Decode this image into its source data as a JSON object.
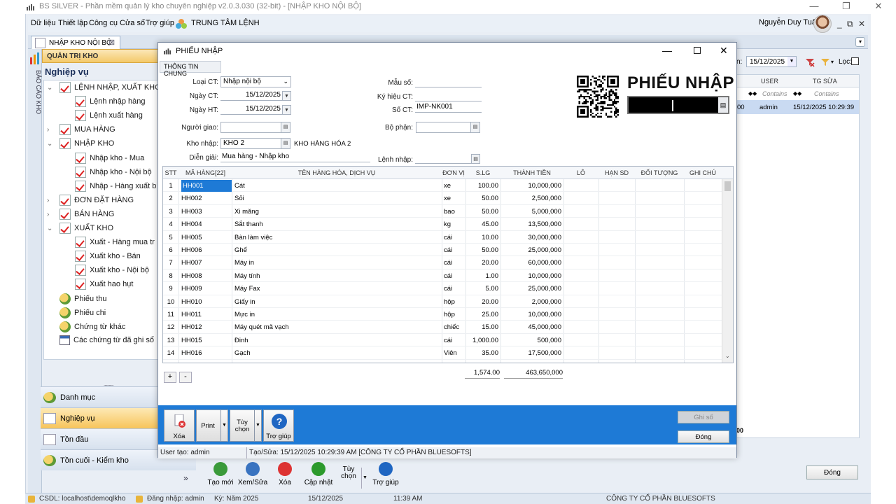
{
  "window": {
    "title": "BS SILVER - Phần mềm quản lý kho chuyên nghiệp v2.0.3.030 (32-bit) - [NHẬP KHO NỘI BỘ]",
    "minimize": "—",
    "restore": "❐",
    "close": "✕"
  },
  "menu": {
    "items": [
      "Dữ liệu",
      "Thiết lập",
      "Công cụ",
      "Cửa sổ",
      "Trợ giúp",
      "TRUNG TÂM LỆNH"
    ],
    "user_name": "Nguyễn Duy Tuấn",
    "mdi_min": "_",
    "mdi_restore": "⧉",
    "mdi_close": "✕"
  },
  "doc_tab": {
    "label": "NHẬP KHO NỘI BỘ",
    "close": "⊠"
  },
  "side_label": "BÁO CÁO KHO",
  "nav": {
    "header": "QUẢN TRỊ KHO",
    "title": "Nghiệp vụ",
    "tree": [
      {
        "label": "LỆNH NHẬP, XUẤT KHO",
        "level": 0,
        "icon": "check",
        "toggle": "v"
      },
      {
        "label": "Lệnh nhập hàng",
        "level": 1,
        "icon": "check"
      },
      {
        "label": "Lệnh xuất hàng",
        "level": 1,
        "icon": "check"
      },
      {
        "label": "MUA HÀNG",
        "level": 0,
        "icon": "check",
        "toggle": ">"
      },
      {
        "label": "NHẬP KHO",
        "level": 0,
        "icon": "check",
        "toggle": "v"
      },
      {
        "label": "Nhập kho - Mua",
        "level": 1,
        "icon": "check"
      },
      {
        "label": "Nhập kho - Nội bộ",
        "level": 1,
        "icon": "check"
      },
      {
        "label": "Nhập - Hàng xuất b",
        "level": 1,
        "icon": "check"
      },
      {
        "label": "ĐƠN ĐẶT HÀNG",
        "level": 0,
        "icon": "check",
        "toggle": ">"
      },
      {
        "label": "BÁN HÀNG",
        "level": 0,
        "icon": "check",
        "toggle": ">"
      },
      {
        "label": "XUẤT KHO",
        "level": 0,
        "icon": "check",
        "toggle": "v"
      },
      {
        "label": "Xuất - Hàng mua tr",
        "level": 1,
        "icon": "check"
      },
      {
        "label": "Xuất kho - Bán",
        "level": 1,
        "icon": "check"
      },
      {
        "label": "Xuất kho - Nội bộ",
        "level": 1,
        "icon": "check"
      },
      {
        "label": "Xuất hao hụt",
        "level": 1,
        "icon": "check"
      },
      {
        "label": "Phiếu thu",
        "level": 0,
        "icon": "coin"
      },
      {
        "label": "Phiếu chi",
        "level": 0,
        "icon": "coin"
      },
      {
        "label": "Chứng từ khác",
        "level": 0,
        "icon": "coin"
      },
      {
        "label": "Các chứng từ đã ghi sổ",
        "level": 0,
        "icon": "cal"
      }
    ],
    "bars": [
      {
        "label": "Danh mục",
        "selected": false
      },
      {
        "label": "Nghiệp vụ",
        "selected": true
      },
      {
        "label": "Tồn đầu",
        "selected": false
      },
      {
        "label": "Tồn cuối - Kiểm kho",
        "selected": false
      }
    ],
    "more": "»"
  },
  "right": {
    "date_label": "n:",
    "date": "15/12/2025",
    "filter_label": "Lọc:",
    "col_user": "USER",
    "col_tg": "TG SỬA",
    "contains1": "Contains",
    "contains2": "Contains",
    "row_val_prefix": "00",
    "row_user": "admin",
    "row_tg": "15/12/2025 10:29:39",
    "footer_prefix": "00"
  },
  "main_buttons": [
    {
      "label": "Tạo mới",
      "icon": "add-icon"
    },
    {
      "label": "Xem/Sửa",
      "icon": "edit-icon"
    },
    {
      "label": "Xóa",
      "icon": "delete-icon"
    },
    {
      "label": "Cập nhật",
      "icon": "check-icon"
    },
    {
      "label": "Tùy chọn",
      "icon": "options-icon"
    },
    {
      "label": "Trợ giúp",
      "icon": "help-icon"
    }
  ],
  "main_close": "Đóng",
  "status": {
    "db": "CSDL: localhost\\demoqlkho",
    "login": "Đăng nhập: admin",
    "period": "Kỳ: Năm 2025",
    "date": "15/12/2025",
    "time": "11:39 AM",
    "company": "CÔNG TY CỔ PHẦN BLUESOFTS"
  },
  "dialog": {
    "title": "PHIẾU NHẬP",
    "tab": "THÔNG TIN CHUNG",
    "big_title": "PHIẾU NHẬP",
    "fields": {
      "loai_ct_label": "Loại CT:",
      "loai_ct": "Nhập nội bộ",
      "ngay_ct_label": "Ngày CT:",
      "ngay_ct": "15/12/2025",
      "ngay_ht_label": "Ngày HT:",
      "ngay_ht": "15/12/2025",
      "nguoi_giao_label": "Người giao:",
      "nguoi_giao": "",
      "kho_nhap_label": "Kho nhập:",
      "kho_nhap": "KHO 2",
      "kho_nhap_name": "KHO HÀNG HÓA 2",
      "dien_giai_label": "Diễn giải:",
      "dien_giai": "Mua hàng - Nhập kho",
      "mau_so_label": "Mẫu số:",
      "mau_so": "",
      "ky_hieu_label": "Ký hiệu CT:",
      "ky_hieu": "",
      "so_ct_label": "Số CT:",
      "so_ct": "IMP-NK001",
      "bo_phan_label": "Bộ phận:",
      "bo_phan": "",
      "lenh_nhap_label": "Lệnh nhập:",
      "lenh_nhap": ""
    },
    "grid": {
      "headers": [
        "STT",
        "MÃ HÀNG[22]",
        "TÊN HÀNG HÓA, DỊCH VỤ",
        "ĐƠN VỊ",
        "S.LG",
        "THÀNH TIỀN",
        "LÔ",
        "HẠN SD",
        "ĐỐI TƯỢNG",
        "GHI CHÚ"
      ],
      "rows": [
        [
          "1",
          "HH001",
          "Cát",
          "xe",
          "100.00",
          "10,000,000"
        ],
        [
          "2",
          "HH002",
          "Sỏi",
          "xe",
          "50.00",
          "2,500,000"
        ],
        [
          "3",
          "HH003",
          "Xi măng",
          "bao",
          "50.00",
          "5,000,000"
        ],
        [
          "4",
          "HH004",
          "Sắt thanh",
          "kg",
          "45.00",
          "13,500,000"
        ],
        [
          "5",
          "HH005",
          "Bàn làm việc",
          "cái",
          "10.00",
          "30,000,000"
        ],
        [
          "6",
          "HH006",
          "Ghế",
          "cái",
          "50.00",
          "25,000,000"
        ],
        [
          "7",
          "HH007",
          "Máy in",
          "cái",
          "20.00",
          "60,000,000"
        ],
        [
          "8",
          "HH008",
          "Máy tính",
          "cái",
          "1.00",
          "10,000,000"
        ],
        [
          "9",
          "HH009",
          "Máy Fax",
          "cái",
          "5.00",
          "25,000,000"
        ],
        [
          "10",
          "HH010",
          "Giấy in",
          "hộp",
          "20.00",
          "2,000,000"
        ],
        [
          "11",
          "HH011",
          "Mực in",
          "hộp",
          "25.00",
          "10,000,000"
        ],
        [
          "12",
          "HH012",
          "Máy quét mã vạch",
          "chiếc",
          "15.00",
          "45,000,000"
        ],
        [
          "13",
          "HH015",
          "Đinh",
          "cái",
          "1,000.00",
          "500,000"
        ],
        [
          "14",
          "HH016",
          "Gạch",
          "Viên",
          "35.00",
          "17,500,000"
        ]
      ],
      "total_qty": "1,574.00",
      "total_amount": "463,650,000",
      "add": "+",
      "remove": "-"
    },
    "buttons": {
      "xoa": "Xóa",
      "print": "Print",
      "tuy_chon": "Tùy chọn",
      "tro_giup": "Trợ giúp",
      "ghi_so": "Ghi sổ",
      "dong": "Đóng"
    },
    "status": {
      "user": "User tạo: admin",
      "info": "Tạo/Sửa: 15/12/2025 10:29:39 AM [CÔNG TY CỔ PHẦN BLUESOFTS]"
    }
  }
}
